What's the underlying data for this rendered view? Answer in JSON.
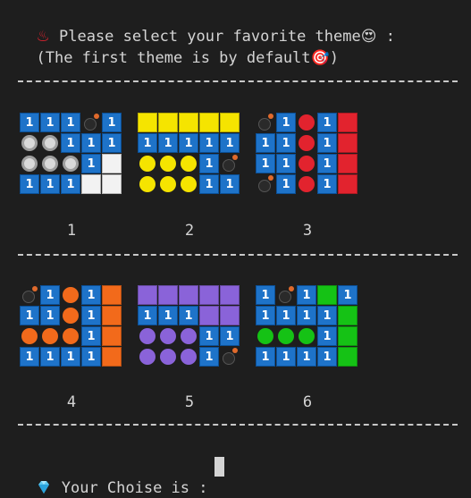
{
  "title_line1": "Please select your favorite theme",
  "title_line1_suffix": " :",
  "title_line2": "(The first theme is by default",
  "title_line2_suffix": ")",
  "emoji_hot_springs": "♨",
  "emoji_star_eyes": "😍",
  "emoji_target": "🎯",
  "separator_text": "------------------------------------------------",
  "prompt_label": "Your Choise is :",
  "colors": {
    "number_cell": "#1e73c9",
    "gray": "#d0d0d0",
    "yellow": "#f5e400",
    "red": "#e2232e",
    "orange": "#f26a1b",
    "purple": "#8a63d9",
    "green": "#15c215",
    "white": "#f2f2f2"
  },
  "themes": [
    {
      "label": "1",
      "color": "white",
      "circle_color": "gray",
      "ring": true,
      "rows": [
        [
          "1",
          "1",
          "1",
          "B",
          "1"
        ],
        [
          "C",
          "C",
          "1",
          "1",
          "1"
        ],
        [
          "C",
          "C",
          "C",
          "1",
          "S"
        ],
        [
          "1",
          "1",
          "1",
          "S",
          "S"
        ]
      ]
    },
    {
      "label": "2",
      "color": "yellow",
      "circle_color": "yellow",
      "rows": [
        [
          "S",
          "S",
          "S",
          "S",
          "S"
        ],
        [
          "1",
          "1",
          "1",
          "1",
          "1"
        ],
        [
          "C",
          "C",
          "C",
          "1",
          "B"
        ],
        [
          "C",
          "C",
          "C",
          "1",
          "1"
        ]
      ]
    },
    {
      "label": "3",
      "color": "red",
      "circle_color": "red",
      "rows": [
        [
          "B",
          "1",
          "C",
          "1",
          "S"
        ],
        [
          "1",
          "1",
          "C",
          "1",
          "S"
        ],
        [
          "1",
          "1",
          "C",
          "1",
          "S"
        ],
        [
          "B",
          "1",
          "C",
          "1",
          "S"
        ]
      ]
    },
    {
      "label": "4",
      "color": "orange",
      "circle_color": "orange",
      "rows": [
        [
          "B",
          "1",
          "C",
          "1",
          "S"
        ],
        [
          "1",
          "1",
          "C",
          "1",
          "S"
        ],
        [
          "C",
          "C",
          "C",
          "1",
          "S"
        ],
        [
          "1",
          "1",
          "1",
          "1",
          "S"
        ]
      ]
    },
    {
      "label": "5",
      "color": "purple",
      "circle_color": "purple",
      "rows": [
        [
          "S",
          "S",
          "S",
          "S",
          "S"
        ],
        [
          "1",
          "1",
          "1",
          "S",
          "S"
        ],
        [
          "C",
          "C",
          "C",
          "1",
          "1"
        ],
        [
          "C",
          "C",
          "C",
          "1",
          "B"
        ]
      ]
    },
    {
      "label": "6",
      "color": "green",
      "circle_color": "green",
      "rows": [
        [
          "1",
          "B",
          "1",
          "S",
          "1"
        ],
        [
          "1",
          "1",
          "1",
          "1",
          "S"
        ],
        [
          "C",
          "C",
          "C",
          "1",
          "S"
        ],
        [
          "1",
          "1",
          "1",
          "1",
          "S"
        ]
      ]
    }
  ]
}
